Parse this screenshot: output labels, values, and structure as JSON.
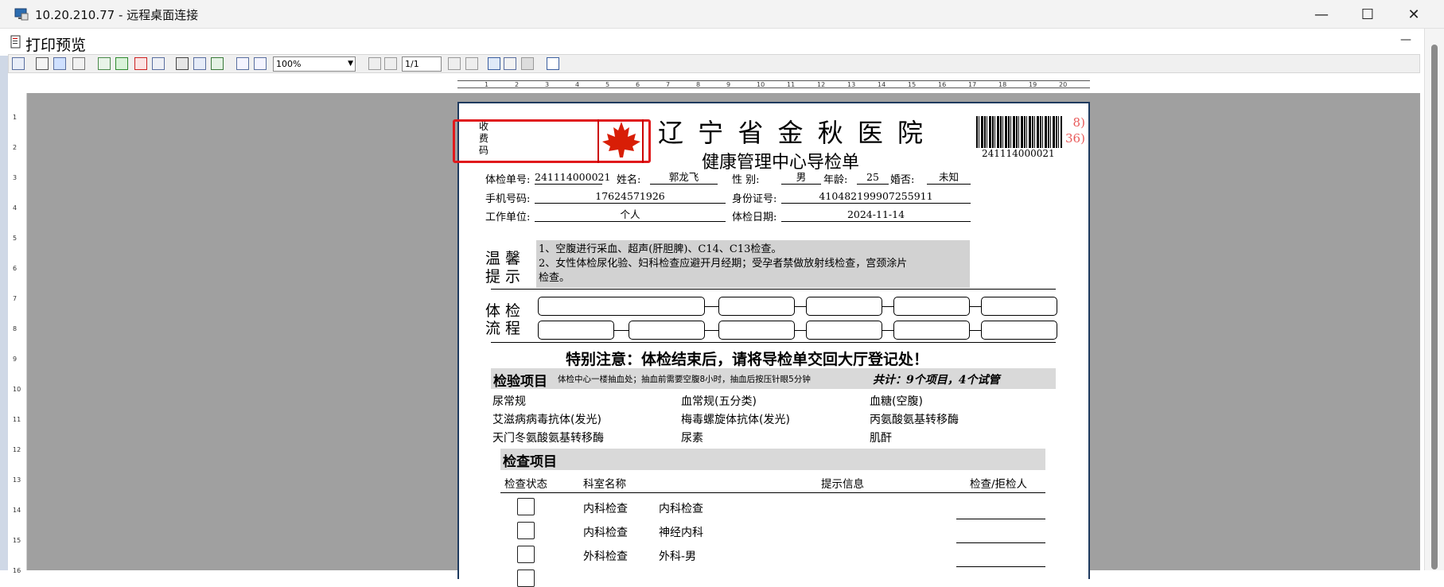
{
  "window": {
    "title": "10.20.210.77 - 远程桌面连接",
    "minimize": "—",
    "maximize": "☐",
    "close": "✕"
  },
  "app": {
    "title": "打印预览",
    "minimize": "—"
  },
  "toolbar": {
    "zoom_value": "100%",
    "page_value": "1/1"
  },
  "colors": {
    "highlight_box": "#e0191c",
    "maple_leaf": "#d81e06",
    "tip_bg": "#d2d2d2",
    "section_bg": "#d9d9d9",
    "paper_border": "#1e3a5f",
    "preview_bg": "#a0a0a0"
  },
  "document": {
    "fee_code_label": "收\n费\n码",
    "hospital_name": "辽 宁 省 金 秋 医 院",
    "form_title": "健康管理中心导检单",
    "barcode_number": "241114000021",
    "barcode_side_red": "8)\n36)",
    "fields": {
      "exam_no_label": "体检单号:",
      "exam_no_value": "241114000021",
      "name_label": "姓名:",
      "name_value": "郭龙飞",
      "gender_label": "性    别:",
      "gender_value": "男",
      "age_label": "年龄:",
      "age_value": "25",
      "marital_label": "婚否:",
      "marital_value": "未知",
      "phone_label": "手机号码:",
      "phone_value": "17624571926",
      "id_label": "身份证号:",
      "id_value": "410482199907255911",
      "work_label": "工作单位:",
      "work_value": "个人",
      "exam_date_label": "体检日期:",
      "exam_date_value": "2024-11-14"
    },
    "tips_label_1": "温 馨",
    "tips_label_2": "提 示",
    "tips_lines": [
      "1、空腹进行采血、超声(肝胆脾)、C14、C13检查。",
      "2、女性体检尿化验、妇科检查应避开月经期；受孕者禁做放射线检查，宫颈涂片",
      "检查。"
    ],
    "flow_label_1": "体 检",
    "flow_label_2": "流 程",
    "notice": "特别注意：体检结束后，请将导检单交回大厅登记处！",
    "lab_section_title": "检验项目",
    "lab_section_note": "体检中心一楼抽血处；抽血前需要空腹8小时，抽血后按压针眼5分钟",
    "lab_summary_handwritten": "共计：9个项目，4个试管",
    "lab_items": [
      [
        "尿常规",
        "血常规(五分类)",
        "血糖(空腹)"
      ],
      [
        "艾滋病病毒抗体(发光)",
        "梅毒螺旋体抗体(发光)",
        "丙氨酸氨基转移酶"
      ],
      [
        "天门冬氨酸氨基转移酶",
        "尿素",
        "肌酐"
      ]
    ],
    "check_section_title": "检查项目",
    "check_columns": [
      "检查状态",
      "科室名称",
      "提示信息",
      "检查/拒检人"
    ],
    "check_rows": [
      {
        "dept": "内科检查",
        "item": "内科检查"
      },
      {
        "dept": "内科检查",
        "item": "神经内科"
      },
      {
        "dept": "外科检查",
        "item": "外科-男"
      }
    ]
  }
}
